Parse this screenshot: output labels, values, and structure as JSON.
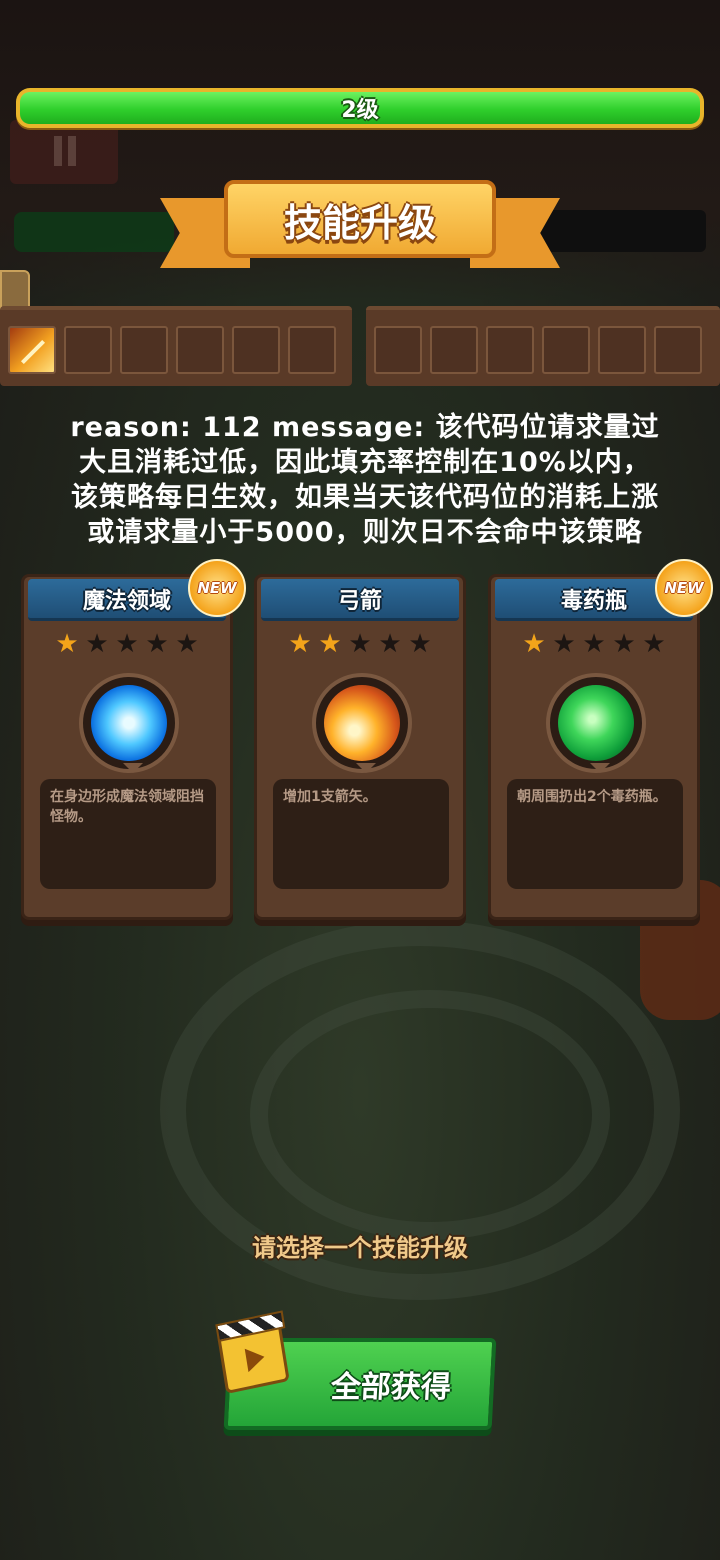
{
  "level": {
    "label": "2级",
    "progress": 1.0
  },
  "banner": {
    "title": "技能升级"
  },
  "skill_bar": {
    "left_slots": [
      {
        "icon": "arrow-skill-icon",
        "filled": true
      },
      {
        "filled": false
      },
      {
        "filled": false
      },
      {
        "filled": false
      },
      {
        "filled": false
      },
      {
        "filled": false
      }
    ],
    "right_slots": [
      {
        "filled": false
      },
      {
        "filled": false
      },
      {
        "filled": false
      },
      {
        "filled": false
      },
      {
        "filled": false
      },
      {
        "filled": false
      }
    ]
  },
  "overlay_message": "reason: 112  message: 该代码位请求量过大且消耗过低，因此填充率控制在10%以内，该策略每日生效，如果当天该代码位的消耗上涨或请求量小于5000，则次日不会命中该策略",
  "cards": [
    {
      "title": "魔法领域",
      "badge": "NEW",
      "stars": 1,
      "max_stars": 5,
      "icon": "magic-field-icon",
      "description": "在身边形成魔法领域阻挡怪物。"
    },
    {
      "title": "弓箭",
      "badge": "",
      "stars": 2,
      "max_stars": 5,
      "icon": "arrow-icon",
      "description": "增加1支箭矢。"
    },
    {
      "title": "毒药瓶",
      "badge": "NEW",
      "stars": 1,
      "max_stars": 5,
      "icon": "poison-bottle-icon",
      "description": "朝周围扔出2个毒药瓶。"
    }
  ],
  "prompt": "请选择一个技能升级",
  "get_all_button": {
    "label": "全部获得",
    "icon": "video-clapper-icon"
  }
}
